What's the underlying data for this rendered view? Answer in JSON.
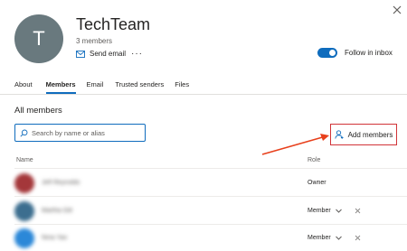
{
  "header": {
    "avatar_initial": "T",
    "group_name": "TechTeam",
    "member_count": "3 members",
    "send_email_label": "Send email",
    "more_label": "···",
    "follow_label": "Follow in inbox",
    "follow_enabled": true
  },
  "tabs": [
    {
      "label": "About",
      "active": false
    },
    {
      "label": "Members",
      "active": true
    },
    {
      "label": "Email",
      "active": false
    },
    {
      "label": "Trusted senders",
      "active": false
    },
    {
      "label": "Files",
      "active": false
    }
  ],
  "members": {
    "section_title": "All members",
    "search_placeholder": "Search by name or alias",
    "add_members_label": "Add members",
    "columns": {
      "name": "Name",
      "role": "Role"
    },
    "rows": [
      {
        "name": "Jeff Reynolds",
        "role": "Owner",
        "avatar_color": "#a4373a",
        "editable": false
      },
      {
        "name": "Martha Gill",
        "role": "Member",
        "avatar_color": "#3c6e8f",
        "editable": true
      },
      {
        "name": "Nina Yao",
        "role": "Member",
        "avatar_color": "#2b88d8",
        "editable": true
      }
    ]
  },
  "colors": {
    "accent": "#0f6cbd",
    "highlight": "#d13438",
    "annotation_arrow": "#e8401c"
  }
}
